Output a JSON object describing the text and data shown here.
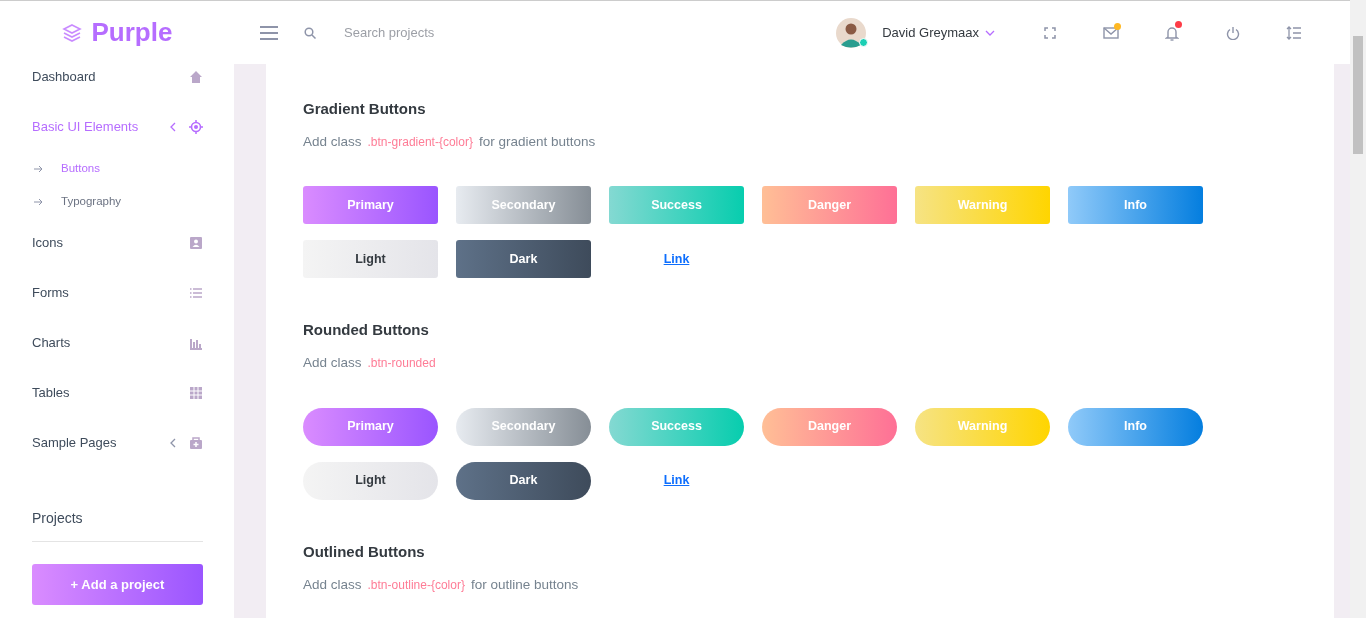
{
  "brand": {
    "name": "Purple"
  },
  "search": {
    "placeholder": "Search projects"
  },
  "user": {
    "name": "David Greymaax"
  },
  "top_icons": [
    {
      "kind": "fullscreen"
    },
    {
      "kind": "mail",
      "color": "#ffb822"
    },
    {
      "kind": "bell",
      "color": "#fe3c47"
    },
    {
      "kind": "power"
    },
    {
      "kind": "menu-right"
    }
  ],
  "sidebar": {
    "items": [
      {
        "label": "Dashboard",
        "kind": "link",
        "selected": false
      },
      {
        "label": "Basic UI Elements",
        "kind": "submenu",
        "selected": true,
        "children": [
          {
            "label": "Buttons",
            "selected": true
          },
          {
            "label": "Typography",
            "selected": false
          }
        ]
      },
      {
        "label": "Icons",
        "kind": "link",
        "selected": false
      },
      {
        "label": "Forms",
        "kind": "link",
        "selected": false
      },
      {
        "label": "Charts",
        "kind": "link",
        "selected": false
      },
      {
        "label": "Tables",
        "kind": "link",
        "selected": false
      },
      {
        "label": "Sample Pages",
        "kind": "submenu",
        "selected": false
      }
    ],
    "projects_title": "Projects",
    "add_button": "+ Add a project"
  },
  "sections": [
    {
      "title": "Gradient Buttons",
      "description": {
        "before": "Add class",
        "code": ".btn-gradient-{color}",
        "after": "for gradient buttons"
      },
      "kind": "square",
      "buttons": [
        {
          "label": "Primary",
          "kind": "button"
        },
        {
          "label": "Secondary",
          "kind": "button"
        },
        {
          "label": "Success",
          "kind": "button"
        },
        {
          "label": "Danger",
          "kind": "button"
        },
        {
          "label": "Warning",
          "kind": "button"
        },
        {
          "label": "Info",
          "kind": "button"
        },
        {
          "label": "Light",
          "kind": "button"
        },
        {
          "label": "Dark",
          "kind": "button"
        },
        {
          "label": "Link",
          "kind": "link"
        }
      ]
    },
    {
      "title": "Rounded Buttons",
      "description": {
        "before": "Add class",
        "code": ".btn-rounded"
      },
      "kind": "rounded",
      "buttons": [
        {
          "label": "Primary",
          "kind": "button"
        },
        {
          "label": "Secondary",
          "kind": "button"
        },
        {
          "label": "Success",
          "kind": "button"
        },
        {
          "label": "Danger",
          "kind": "button"
        },
        {
          "label": "Warning",
          "kind": "button"
        },
        {
          "label": "Info",
          "kind": "button"
        },
        {
          "label": "Light",
          "kind": "button"
        },
        {
          "label": "Dark",
          "kind": "button"
        },
        {
          "label": "Link",
          "kind": "link"
        }
      ]
    },
    {
      "title": "Outlined Buttons",
      "description": {
        "before": "Add class",
        "code": ".btn-outline-{color}",
        "after": "for outline buttons"
      }
    }
  ]
}
